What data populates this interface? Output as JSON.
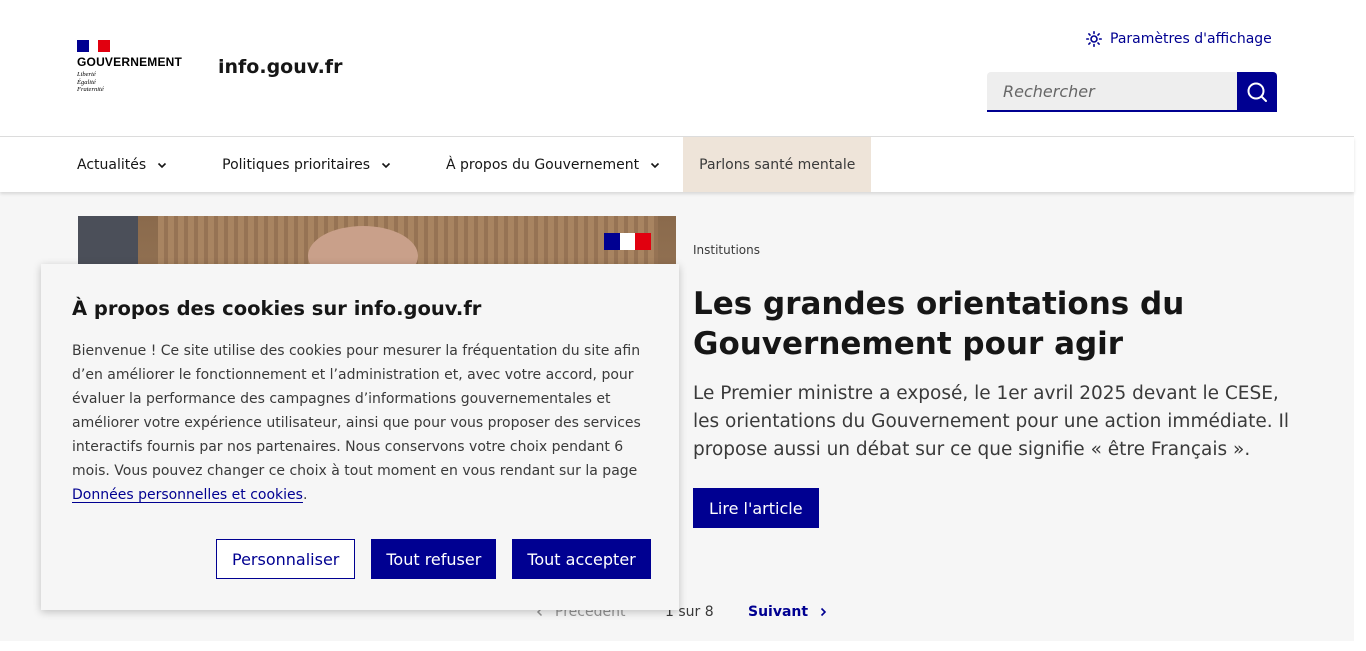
{
  "header": {
    "logo": {
      "title": "GOUVERNEMENT",
      "motto": [
        "Liberté",
        "Égalité",
        "Fraternité"
      ]
    },
    "site_name": "info.gouv.fr",
    "display_settings_label": "Paramètres d'affichage",
    "search": {
      "placeholder": "Rechercher"
    }
  },
  "nav": {
    "items": [
      {
        "label": "Actualités",
        "has_dropdown": true
      },
      {
        "label": "Politiques prioritaires",
        "has_dropdown": true
      },
      {
        "label": "À propos du Gouvernement",
        "has_dropdown": true
      },
      {
        "label": "Parlons santé mentale",
        "has_dropdown": false
      }
    ]
  },
  "article": {
    "kicker": "Institutions",
    "title": "Les grandes orientations du Gouvernement pour agir",
    "summary": "Le Premier ministre a exposé, le 1er avril 2025 devant le CESE, les orientations du Gouvernement pour une action immédiate. Il propose aussi un débat sur ce que signifie « être Français ».",
    "cta": "Lire l'article"
  },
  "pager": {
    "prev": "Précédent",
    "count": "1 sur 8",
    "next": "Suivant"
  },
  "cookie": {
    "title": "À propos des cookies sur info.gouv.fr",
    "text": "Bienvenue ! Ce site utilise des cookies pour mesurer la fréquentation du site afin d’en améliorer le fonctionnement et l’administration et, avec votre accord, pour évaluer la performance des campagnes d’informations gouvernementales et améliorer votre expérience utilisateur, ainsi que pour vous proposer des services interactifs fournis par nos partenaires. Nous conservons votre choix pendant 6 mois. Vous pouvez changer ce choix à tout moment en vous rendant sur la page ",
    "link": "Données personnelles et cookies",
    "text_end": ".",
    "buttons": {
      "customize": "Personnaliser",
      "refuse": "Tout refuser",
      "accept": "Tout accepter"
    }
  },
  "colors": {
    "primary": "#000091",
    "marianne_red": "#e1000f",
    "mental_health_bg": "#eee4d9",
    "main_bg": "#f6f6f6"
  }
}
